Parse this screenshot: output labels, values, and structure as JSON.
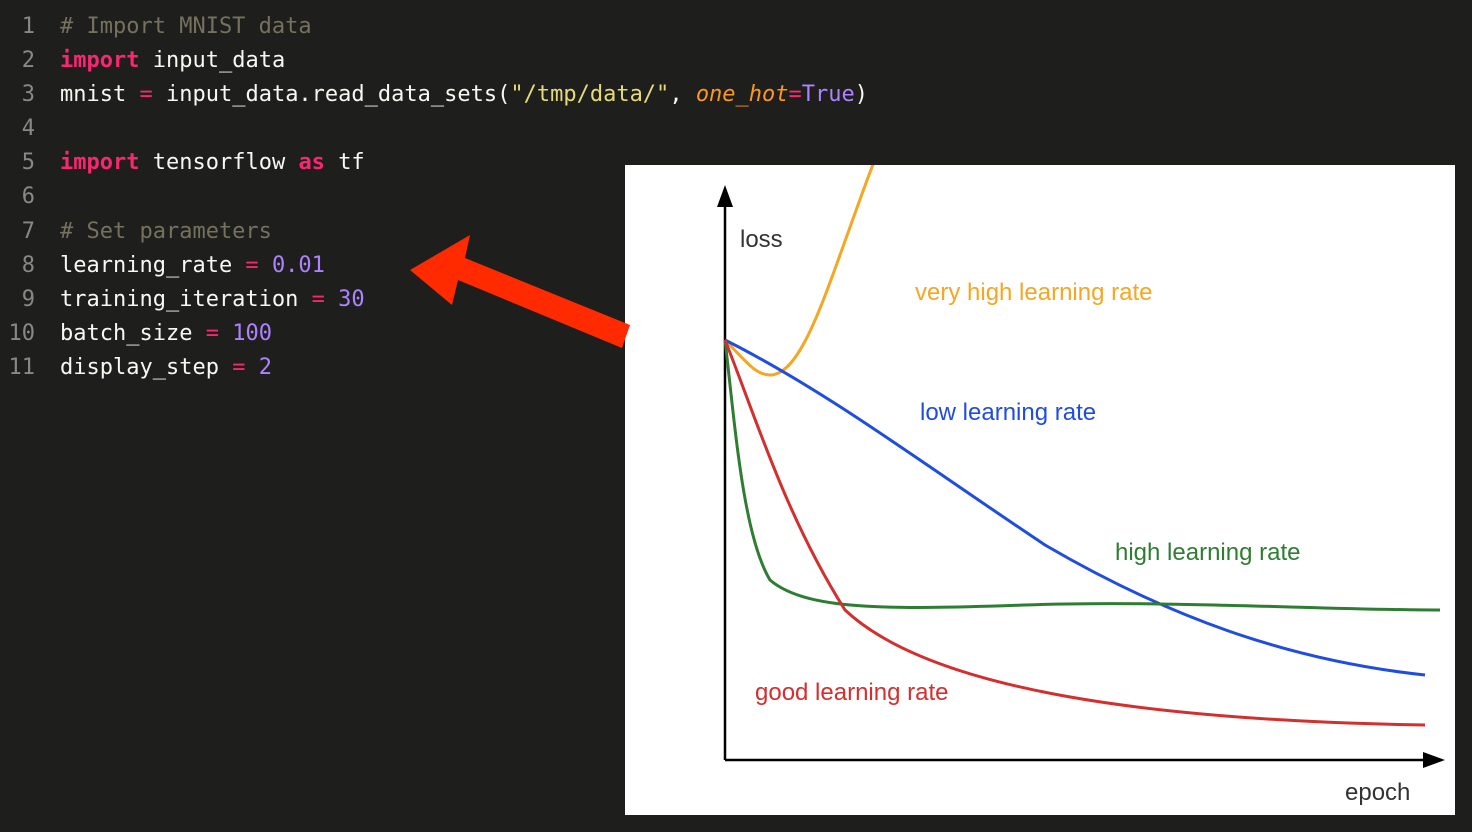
{
  "code": {
    "lines": [
      {
        "n": "1"
      },
      {
        "n": "2"
      },
      {
        "n": "3"
      },
      {
        "n": "4"
      },
      {
        "n": "5"
      },
      {
        "n": "6"
      },
      {
        "n": "7"
      },
      {
        "n": "8"
      },
      {
        "n": "9"
      },
      {
        "n": "10"
      },
      {
        "n": "11"
      }
    ],
    "comment1": "# Import MNIST data",
    "kw_import_1": "import",
    "mod1": "input_data",
    "assign_mnist": "mnist",
    "eq1": " = ",
    "call_read": "input_data.read_data_sets(",
    "str_path": "\"/tmp/data/\"",
    "comma": ", ",
    "kwarg_name": "one_hot",
    "eq2": "=",
    "bool_true": "True",
    "rparen": ")",
    "kw_import_2": "import",
    "mod2": "tensorflow",
    "kw_as": "as",
    "alias_tf": "tf",
    "comment2": "# Set parameters",
    "var_lr": "learning_rate",
    "val_lr": "0.01",
    "var_iter": "training_iteration",
    "val_iter": "30",
    "var_bs": "batch_size",
    "val_bs": "100",
    "var_ds": "display_step",
    "val_ds": "2"
  },
  "chart_data": {
    "type": "line",
    "xlabel": "epoch",
    "ylabel": "loss",
    "series": [
      {
        "name": "very high learning rate",
        "color": "#f5a623",
        "behavior": "diverges upward after initial dip"
      },
      {
        "name": "low learning rate",
        "color": "#1e4de0",
        "behavior": "slow monotonic decrease"
      },
      {
        "name": "high learning rate",
        "color": "#2e7d32",
        "behavior": "fast drop then plateau at higher loss"
      },
      {
        "name": "good learning rate",
        "color": "#d32f2f",
        "behavior": "steep drop then smooth approach to low loss"
      }
    ],
    "labels": {
      "very_high": "very high learning rate",
      "low": "low learning rate",
      "high": "high learning rate",
      "good": "good learning rate"
    }
  }
}
